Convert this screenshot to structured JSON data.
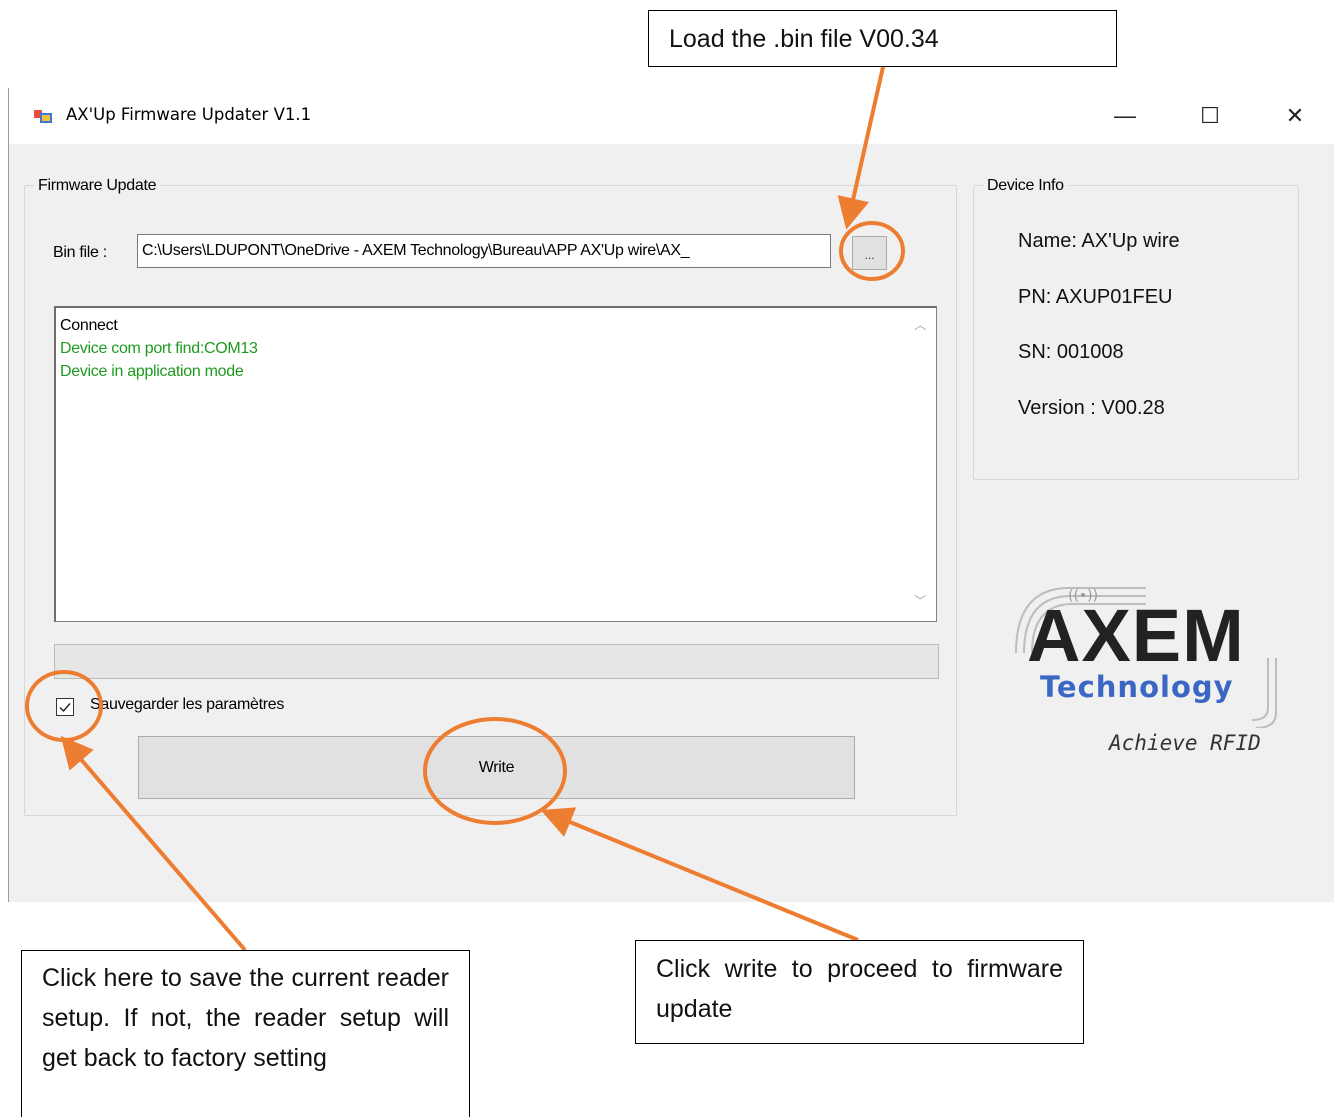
{
  "callouts": {
    "top": "Load the .bin file V00.34",
    "left": "Click here to save the current reader setup. If not, the reader setup will get back to factory setting",
    "right": "Click write to proceed to firmware update"
  },
  "window": {
    "title": "AX'Up Firmware Updater V1.1",
    "controls": {
      "minimize": "—",
      "maximize": "☐",
      "close": "✕"
    }
  },
  "firmware_update": {
    "group_label": "Firmware Update",
    "bin_label": "Bin file :",
    "bin_path": "C:\\Users\\LDUPONT\\OneDrive - AXEM Technology\\Bureau\\APP AX'Up wire\\AX_",
    "browse_label": "...",
    "log": [
      {
        "text": "Connect",
        "color": "#000000"
      },
      {
        "text": "Device com port find:COM13",
        "color": "#1e9b1e"
      },
      {
        "text": "Device in application mode",
        "color": "#1e9b1e"
      }
    ],
    "progress": 0,
    "save_label": "Sauvegarder les paramètres",
    "save_checked": true,
    "write_label": "Write"
  },
  "device_info": {
    "group_label": "Device Info",
    "name": "Name: AX'Up wire",
    "pn": "PN: AXUP01FEU",
    "sn": "SN: 001008",
    "version": "Version : V00.28"
  },
  "logo": {
    "brand": "AXEM",
    "sub": "Technology",
    "tagline": "Achieve RFID"
  },
  "colors": {
    "annotation": "#ed7d31",
    "log_green": "#1e9b1e",
    "logo_blue": "#3a66c4"
  }
}
